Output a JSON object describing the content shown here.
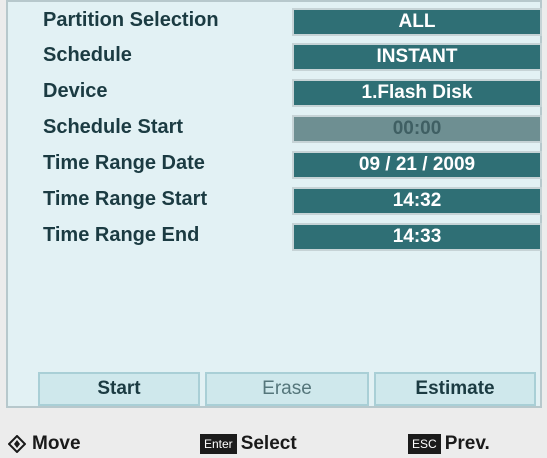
{
  "rows": [
    {
      "label": "Partition Selection",
      "value": "ALL",
      "disabled": false
    },
    {
      "label": "Schedule",
      "value": "INSTANT",
      "disabled": false
    },
    {
      "label": "Device",
      "value": "1.Flash Disk",
      "disabled": false
    },
    {
      "label": "Schedule Start",
      "value": "00:00",
      "disabled": true
    },
    {
      "label": "Time Range Date",
      "value": "09 / 21 / 2009",
      "disabled": false
    },
    {
      "label": "Time Range Start",
      "value": "14:32",
      "disabled": false
    },
    {
      "label": "Time Range End",
      "value": "14:33",
      "disabled": false
    }
  ],
  "buttons": {
    "start_label": "Start",
    "erase_label": "Erase",
    "estimate_label": "Estimate"
  },
  "footer": {
    "move_label": "Move",
    "move_icon": "direction-pad-icon",
    "enter_key": "Enter",
    "select_label": "Select",
    "esc_key": "ESC",
    "prev_label": "Prev."
  },
  "colors": {
    "panel_bg": "#e2f1f4",
    "value_bg": "#2f6f75",
    "value_disabled_bg": "#6e8f92",
    "button_bg": "#cfe8ec",
    "label_text": "#1b3b42"
  }
}
